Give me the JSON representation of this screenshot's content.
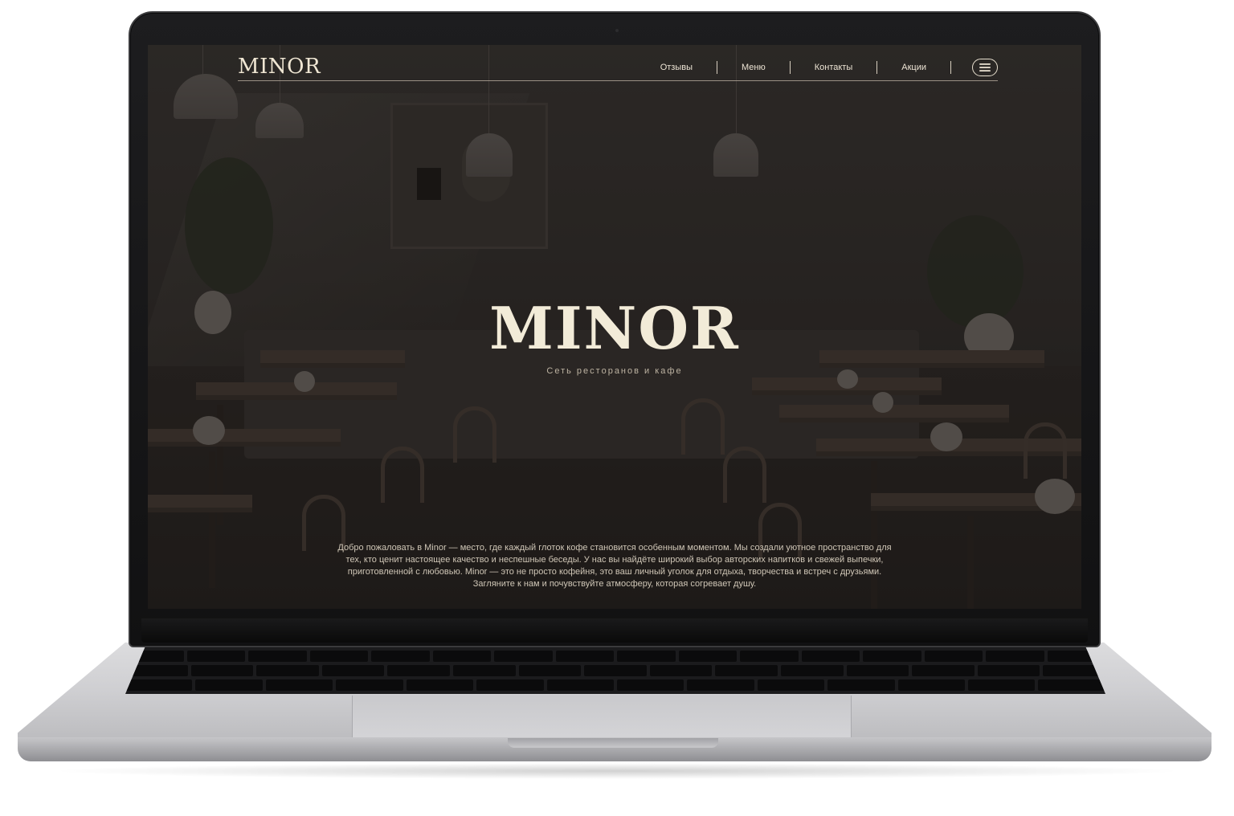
{
  "site": {
    "logo": "MINOR",
    "nav": [
      {
        "label": "Отзывы"
      },
      {
        "label": "Меню"
      },
      {
        "label": "Контакты"
      },
      {
        "label": "Акции"
      }
    ],
    "menu_icon": "hamburger-icon"
  },
  "hero": {
    "title": "MINOR",
    "subtitle": "Сеть ресторанов и кафе",
    "description": "Добро пожаловать в Minor — место, где каждый глоток кофе становится особенным моментом. Мы создали уютное пространство для тех, кто ценит настоящее качество и неспешные беседы. У нас вы найдёте широкий выбор авторских напитков и свежей выпечки, приготовленной с любовью. Minor — это не просто кофейня, это ваш личный уголок для отдыха, творчества и встреч с друзьями. Загляните к нам и почувствуйте атмосферу, которая согревает душу."
  },
  "colors": {
    "text_primary": "#f2ebd8",
    "overlay": "#161210",
    "laptop_body": "#cfcfd2",
    "bezel": "#1d1d1f"
  }
}
